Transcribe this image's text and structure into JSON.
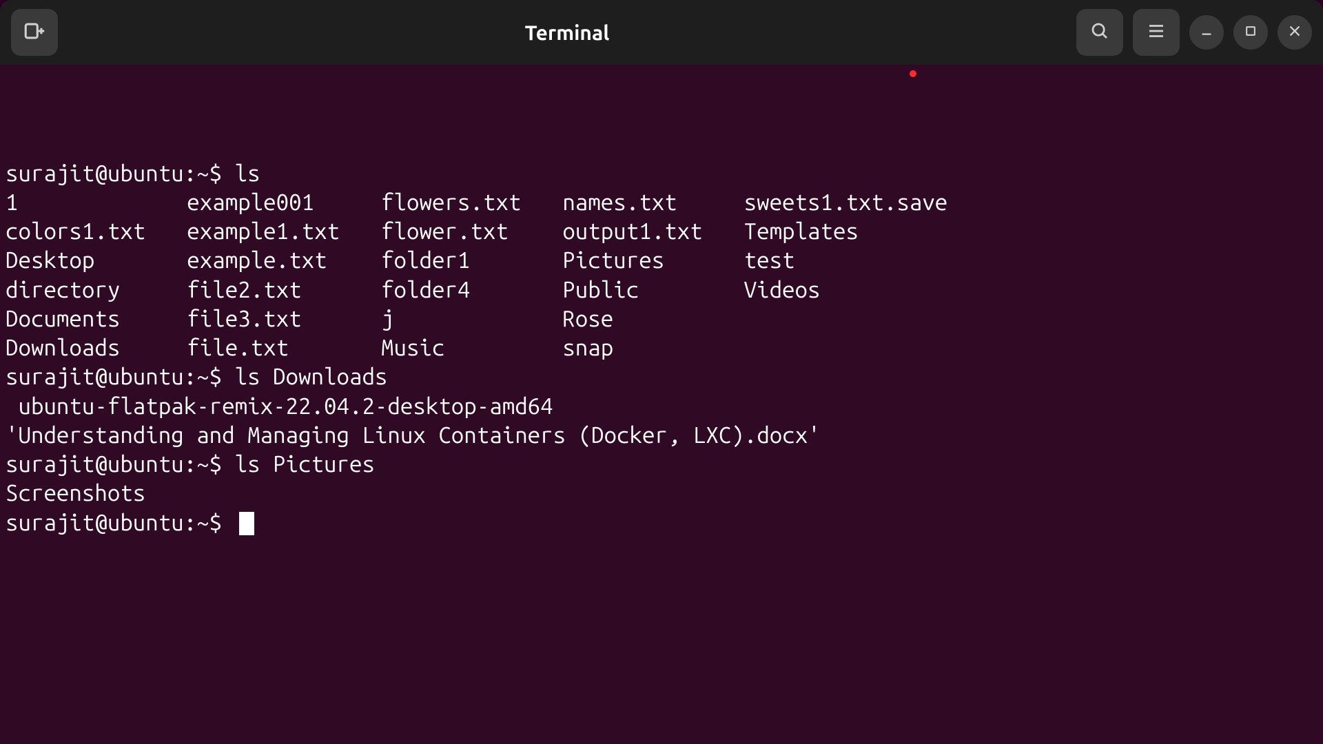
{
  "titlebar": {
    "app_title": "Terminal"
  },
  "prompt": "surajit@ubuntu:~$ ",
  "history": [
    {
      "cmd": "ls",
      "cols": [
        [
          "1",
          "colors1.txt",
          "Desktop",
          "directory",
          "Documents",
          "Downloads"
        ],
        [
          "example001",
          "example1.txt",
          "example.txt",
          "file2.txt",
          "file3.txt",
          "file.txt"
        ],
        [
          "flowers.txt",
          "flower.txt",
          "folder1",
          "folder4",
          "j",
          "Music"
        ],
        [
          "names.txt",
          "output1.txt",
          "Pictures",
          "Public",
          "Rose",
          "snap"
        ],
        [
          "sweets1.txt.save",
          "Templates",
          "test",
          "Videos",
          "",
          ""
        ]
      ]
    },
    {
      "cmd": "ls Downloads",
      "lines": [
        " ubuntu-flatpak-remix-22.04.2-desktop-amd64",
        "'Understanding and Managing Linux Containers (Docker, LXC).docx'"
      ]
    },
    {
      "cmd": "ls Pictures",
      "lines": [
        "Screenshots"
      ]
    }
  ]
}
